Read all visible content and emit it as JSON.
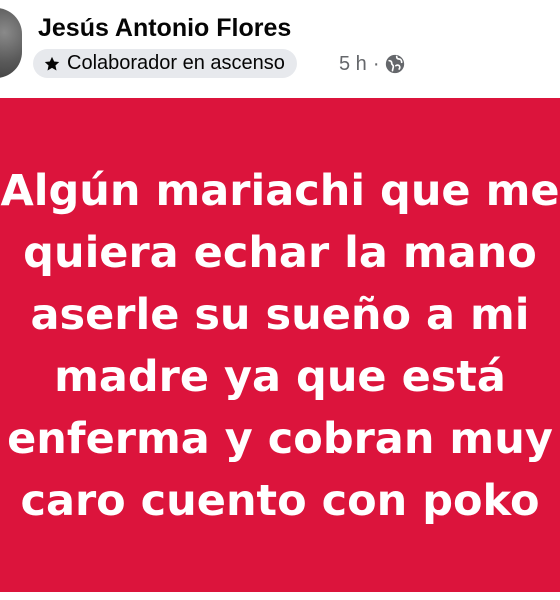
{
  "post": {
    "author": "Jesús Antonio Flores",
    "badge": {
      "icon": "star-icon",
      "label": "Colaborador en ascenso"
    },
    "time": "5 h",
    "separator": "·",
    "audience_icon": "globe-icon"
  },
  "card": {
    "background": "#dc143c",
    "text_color": "#ffffff",
    "lines": [
      "Algún mariachi que me",
      "quiera echar la mano",
      "aserle su sueño a mi",
      "madre ya que está",
      "enferma y cobran muy",
      "caro cuento con poko"
    ]
  }
}
